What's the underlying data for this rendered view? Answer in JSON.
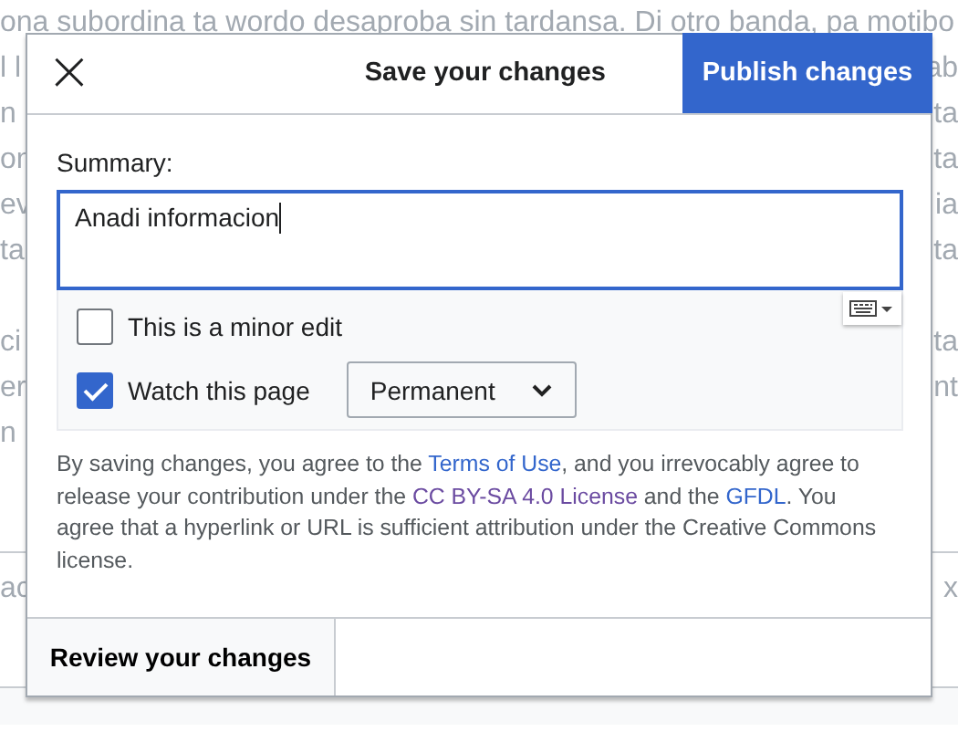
{
  "background": {
    "blocks": [
      [
        {
          "left": "ona subordina ta wordo desaproba sin tardansa. Di otro banda, pa motibo"
        },
        {
          "left": "l l",
          "right": "ab"
        },
        {
          "left": "n",
          "right": "ta"
        },
        {
          "left": "on",
          "right": "ta"
        },
        {
          "left": "ev",
          "right": "ia"
        },
        {
          "left": "ta",
          "right": "ta"
        }
      ],
      [
        {
          "left": "ci",
          "right": "ta"
        },
        {
          "left": "er",
          "right": "nt"
        },
        {
          "left": "n"
        }
      ],
      [
        {
          "left": "ac",
          "right": "x"
        }
      ]
    ]
  },
  "dialog": {
    "title": "Save your changes",
    "close": "×",
    "primary_button": "Publish changes",
    "summary": {
      "label": "Summary:",
      "value": "Anadi informacion"
    },
    "options": [
      {
        "kind": "checkbox",
        "label": "This is a minor edit",
        "checked": false
      },
      {
        "kind": "checkbox",
        "label": "Watch this page",
        "checked": true,
        "dropdown": "Permanent"
      }
    ],
    "legal": [
      {
        "kind": "text",
        "text": "By saving changes, you agree to the "
      },
      {
        "kind": "link",
        "text": "Terms of Use"
      },
      {
        "kind": "text",
        "text": ", and you irrevocably agree to release your contribution under the "
      },
      {
        "kind": "visited_link",
        "text": "CC BY-SA 4.0 License"
      },
      {
        "kind": "text",
        "text": " and the "
      },
      {
        "kind": "link",
        "text": "GFDL"
      },
      {
        "kind": "text",
        "text": ". You agree that a hyperlink or URL is sufficient attribution under the Creative Commons license."
      }
    ],
    "footer_button": "Review your changes"
  }
}
